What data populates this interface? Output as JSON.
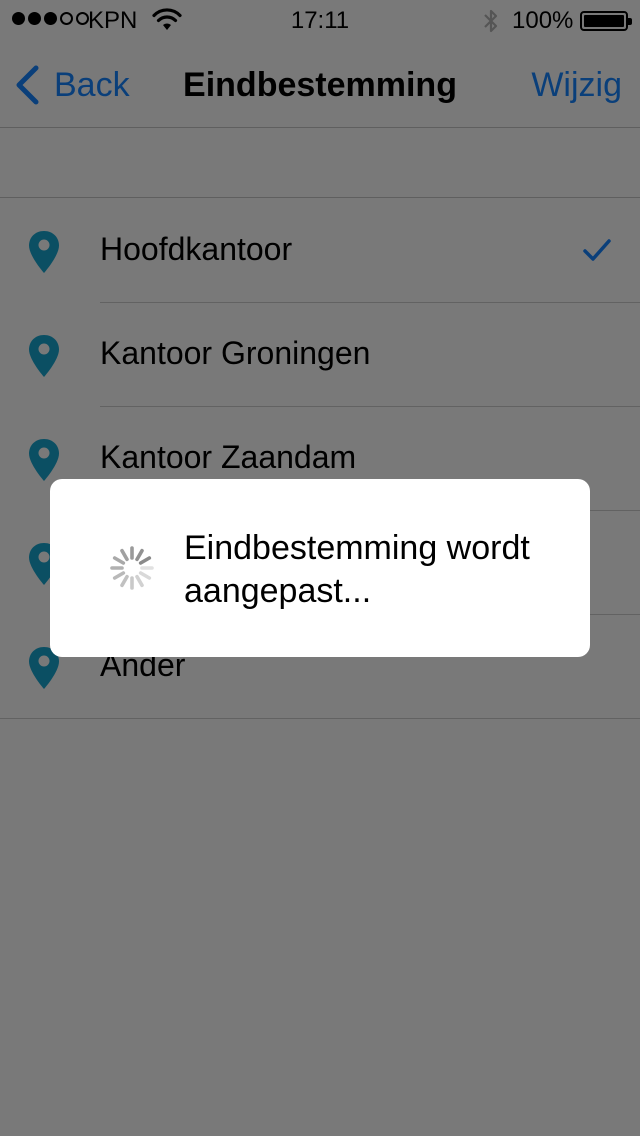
{
  "status_bar": {
    "signal_filled": 3,
    "signal_total": 5,
    "carrier": "KPN",
    "time": "17:11",
    "battery_pct": "100%",
    "battery_level": 1.0
  },
  "nav": {
    "back_label": "Back",
    "title": "Eindbestemming",
    "edit_label": "Wijzig"
  },
  "destinations": [
    {
      "label": "Hoofdkantoor",
      "selected": true
    },
    {
      "label": "Kantoor Groningen",
      "selected": false
    },
    {
      "label": "Kantoor Zaandam",
      "selected": false
    },
    {
      "label": "",
      "selected": false
    },
    {
      "label": "Ander",
      "selected": false
    }
  ],
  "hud": {
    "message": "Eindbestemming wordt aangepast..."
  },
  "colors": {
    "accent": "#0a3f7a",
    "pin": "#0b4f63",
    "overlay_background": "#797979",
    "hud_background": "#ffffff"
  },
  "icons": {
    "back": "chevron-left-icon",
    "pin": "location-pin-icon",
    "check": "checkmark-icon",
    "wifi": "wifi-icon",
    "bluetooth": "bluetooth-icon",
    "battery": "battery-icon",
    "spinner": "activity-spinner-icon"
  }
}
